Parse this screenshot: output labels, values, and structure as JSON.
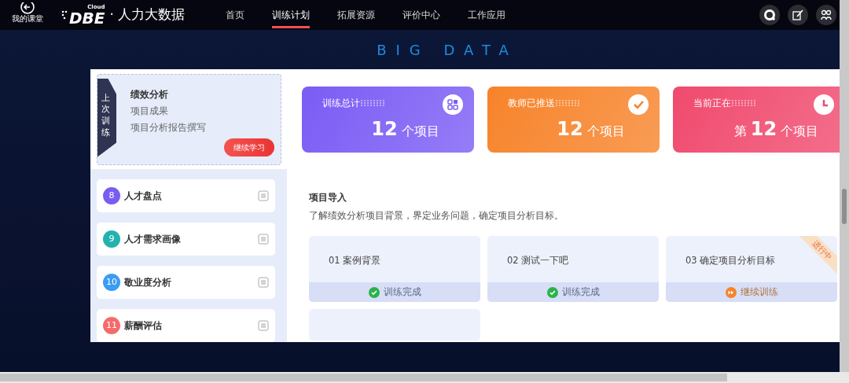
{
  "nav": {
    "back_label": "我的课堂",
    "logo": "DBE",
    "logo_sub": "Cloud",
    "brand": "· 人力大数据",
    "items": [
      {
        "label": "首页",
        "selected": false
      },
      {
        "label": "训练计划",
        "selected": true
      },
      {
        "label": "拓展资源",
        "selected": false
      },
      {
        "label": "评价中心",
        "selected": false
      },
      {
        "label": "工作应用",
        "selected": false
      }
    ]
  },
  "banner_title": "BIG DATA",
  "last_training": {
    "tag": "上次训练",
    "course": "绩效分析",
    "lines": [
      "项目成果",
      "项目分析报告撰写"
    ],
    "button": "继续学习"
  },
  "stats": [
    {
      "kind": "total",
      "label": "训练总计",
      "value": "12",
      "unit": "个项目",
      "color": "#7b5cf5"
    },
    {
      "kind": "pushed",
      "label": "教师已推送",
      "value": "12",
      "unit": "个项目",
      "color": "#f7832a"
    },
    {
      "kind": "current",
      "label": "当前正在",
      "prefix": "第",
      "value": "12",
      "unit": "个项目",
      "color": "#f04a6e"
    }
  ],
  "sidebar": {
    "items": [
      {
        "number": "8",
        "label": "人才盘点",
        "color": "#7a5cf0"
      },
      {
        "number": "9",
        "label": "人才需求画像",
        "color": "#22b3b0"
      },
      {
        "number": "10",
        "label": "敬业度分析",
        "color": "#3a9cf5"
      },
      {
        "number": "11",
        "label": "薪酬评估",
        "color": "#f56b6b"
      }
    ]
  },
  "section": {
    "title": "项目导入",
    "description": "了解绩效分析项目背景，界定业务问题，确定项目分析目标。",
    "tasks": [
      {
        "title": "01 案例背景",
        "kind": "done",
        "action": "训练完成"
      },
      {
        "title": "02 测试一下吧",
        "kind": "done",
        "action": "训练完成"
      },
      {
        "title": "03 确定项目分析目标",
        "kind": "continue",
        "action": "继续训练",
        "ribbon": "进行中"
      }
    ]
  }
}
